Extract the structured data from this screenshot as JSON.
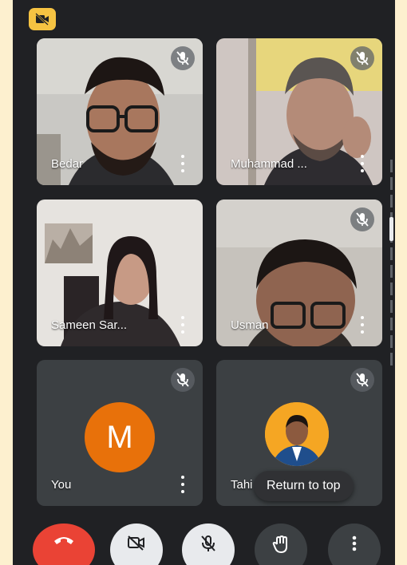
{
  "participants": [
    {
      "name": "Bedar",
      "muted": true
    },
    {
      "name": "Muhammad ...",
      "muted": true
    },
    {
      "name": "Sameen Sar...",
      "muted": false
    },
    {
      "name": "Usman",
      "muted": true
    },
    {
      "name": "You",
      "muted": true,
      "avatar_letter": "M"
    },
    {
      "name": "Tahi",
      "muted": true
    }
  ],
  "return_to_top_label": "Return to top",
  "icons": {
    "camera_off_badge": "video-off-icon",
    "mute": "mic-off-icon",
    "more": "more-vert-icon",
    "end_call": "call-end-icon",
    "camera_toggle": "video-off-icon",
    "mic_toggle": "mic-off-icon",
    "raise_hand": "hand-icon",
    "controls_more": "more-vert-icon"
  },
  "colors": {
    "end_call": "#ea4335",
    "avatar": "#e8710a",
    "camera_off_badge": "#f6c342"
  }
}
